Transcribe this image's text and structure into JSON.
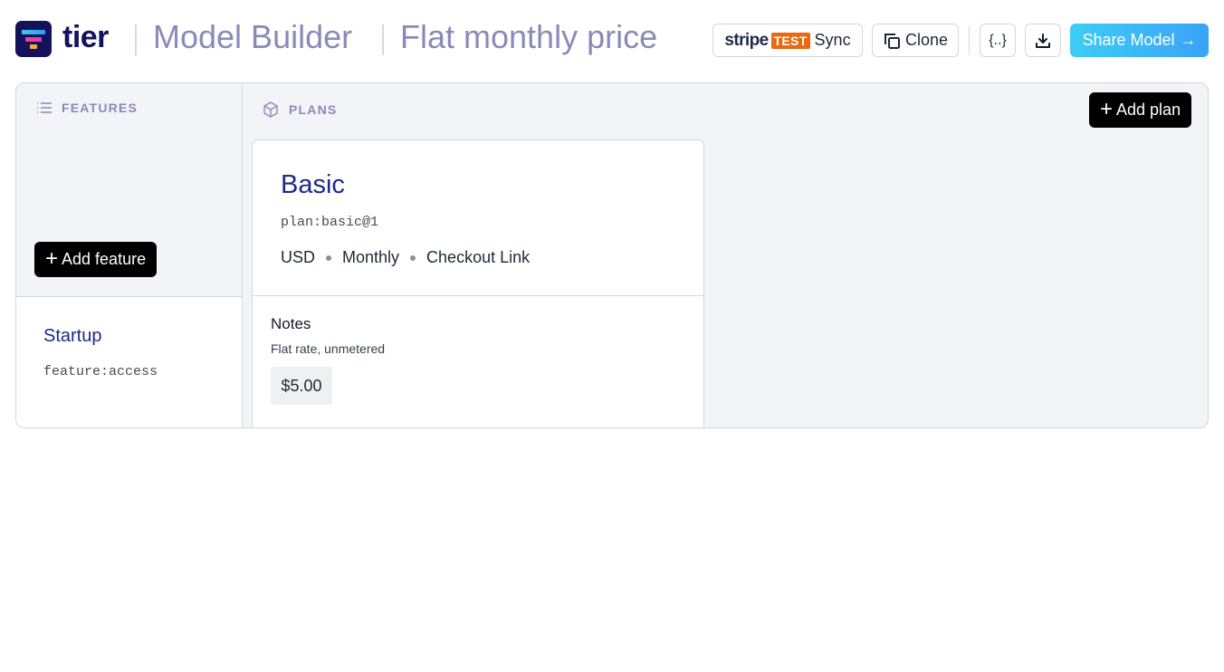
{
  "header": {
    "brand": "tier",
    "section": "Model Builder",
    "model_name": "Flat monthly price",
    "stripe": {
      "wordmark": "stripe",
      "mode_badge": "TEST",
      "label": "Sync"
    },
    "clone_label": "Clone",
    "json_label": "{..}",
    "share_label": "Share Model",
    "share_arrow": "→",
    "colors": {
      "brand": "#14125a",
      "title": "#8a8ab8",
      "test_badge": "#e8690f",
      "share_start": "#3dcdf5",
      "share_end": "#3aa3f7"
    }
  },
  "features": {
    "section_label": "FEATURES",
    "add_label": "Add feature",
    "items": [
      {
        "title": "Startup",
        "key": "feature:access"
      }
    ]
  },
  "plans": {
    "section_label": "PLANS",
    "add_label": "Add plan",
    "items": [
      {
        "name": "Basic",
        "key": "plan:basic@1",
        "currency": "USD",
        "interval": "Monthly",
        "checkout": "Checkout Link",
        "notes_label": "Notes",
        "notes": "Flat rate, unmetered",
        "price": "$5.00"
      }
    ]
  }
}
